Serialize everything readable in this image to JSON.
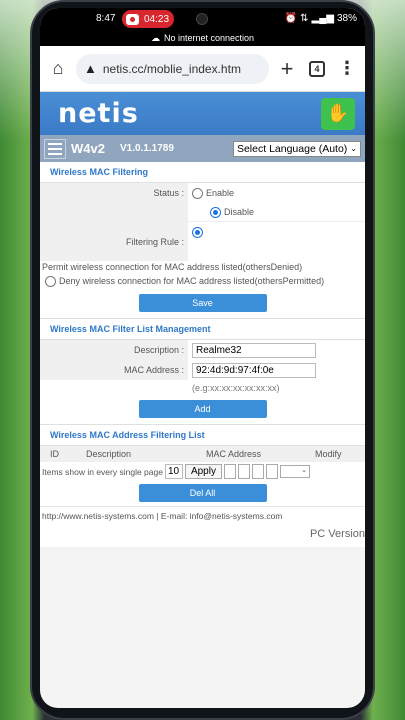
{
  "status_bar": {
    "time": "8:47",
    "record_time": "04:23",
    "battery": "38%"
  },
  "network_notice": "No internet connection",
  "browser": {
    "url": "netis.cc/moblie_index.htm",
    "tab_count": "4"
  },
  "header": {
    "logo": "netis"
  },
  "subbar": {
    "model": "W4v2",
    "version": "V1.0.1.1789",
    "language": "Select Language (Auto)"
  },
  "mac_filtering": {
    "title": "Wireless MAC Filtering",
    "status_label": "Status :",
    "enable": "Enable",
    "disable": "Disable",
    "status_selected": "Disable",
    "rule_label": "Filtering Rule :",
    "permit_text": "Permit wireless connection for MAC address listed(othersDenied)",
    "deny_text": "Deny wireless connection for MAC address listed(othersPermitted)",
    "rule_selected": "permit",
    "save": "Save"
  },
  "list_management": {
    "title": "Wireless MAC Filter List Management",
    "description_label": "Description :",
    "description_value": "Realme32",
    "mac_label": "MAC Address :",
    "mac_value": "92:4d:9d:97:4f:0e",
    "mac_hint": "(e.g:xx:xx:xx:xx:xx:xx)",
    "add": "Add"
  },
  "filter_list": {
    "title": "Wireless MAC Address Filtering List",
    "columns": [
      "ID",
      "Description",
      "MAC Address",
      "Modify"
    ],
    "items_per_page_label": "Items show in every single page",
    "items_per_page": "10",
    "apply": "Apply",
    "del_all": "Del All"
  },
  "footer": {
    "text": "http://www.netis-systems.com | E-mail: info@netis-systems.com",
    "pc_version": "PC Version"
  }
}
